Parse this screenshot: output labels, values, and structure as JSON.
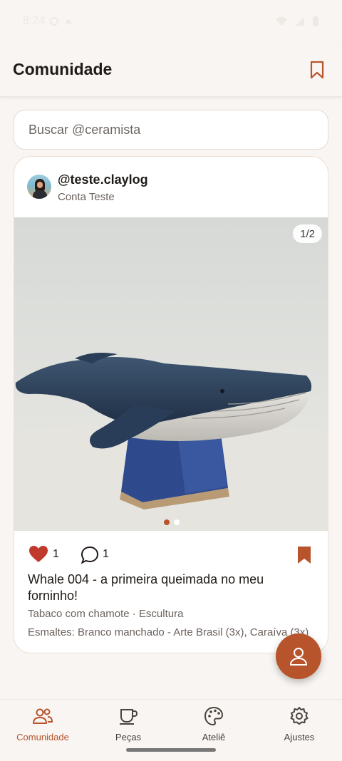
{
  "status_bar": {
    "time": "8:24"
  },
  "header": {
    "title": "Comunidade",
    "bookmark_icon": "bookmark-outline-icon"
  },
  "search": {
    "placeholder": "Buscar @ceramista"
  },
  "post": {
    "handle": "@teste.claylog",
    "display_name": "Conta Teste",
    "image_counter": "1/2",
    "image_total": 2,
    "image_current": 1,
    "likes": "1",
    "comments": "1",
    "saved": true,
    "title": "Whale 004 - a primeira queimada no meu forninho!",
    "meta": "Tabaco com chamote · Escultura",
    "glazes": "Esmaltes: Branco manchado - Arte Brasil (3x), Caraíva (3x)"
  },
  "fab": {
    "icon": "person-icon"
  },
  "bottom_nav": {
    "items": [
      {
        "label": "Comunidade",
        "icon": "people-icon",
        "active": true
      },
      {
        "label": "Peças",
        "icon": "cup-icon",
        "active": false
      },
      {
        "label": "Ateliê",
        "icon": "palette-icon",
        "active": false
      },
      {
        "label": "Ajustes",
        "icon": "gear-icon",
        "active": false
      }
    ]
  },
  "colors": {
    "accent": "#b8542c",
    "background": "#f8f5f2",
    "like_red": "#c0392b"
  }
}
